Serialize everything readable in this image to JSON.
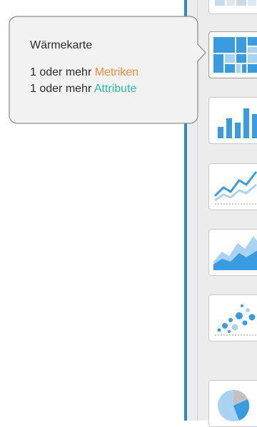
{
  "tooltip": {
    "title": "Wärmekarte",
    "requirements": [
      {
        "prefix": "1 oder mehr",
        "keyword": "Metriken",
        "color": "#f28b3c"
      },
      {
        "prefix": "1 oder mehr",
        "keyword": "Attribute",
        "color": "#2fb8a0"
      }
    ]
  },
  "visualization_types": [
    {
      "icon": "partial-top-icon",
      "state": "default"
    },
    {
      "icon": "heatmap-icon",
      "state": "selected"
    },
    {
      "icon": "bar-chart-icon",
      "state": "default"
    },
    {
      "icon": "line-chart-icon",
      "state": "default"
    },
    {
      "icon": "area-chart-icon",
      "state": "default"
    },
    {
      "icon": "scatter-plot-icon",
      "state": "default"
    },
    {
      "icon": "pie-chart-icon",
      "state": "default"
    }
  ],
  "colors": {
    "icon_blue": "#3a9ce0",
    "icon_light_blue": "#a9d3f2",
    "panel_accent": "#2f86c9",
    "panel_background": "#ececec",
    "tooltip_background": "#f2f2f2"
  }
}
